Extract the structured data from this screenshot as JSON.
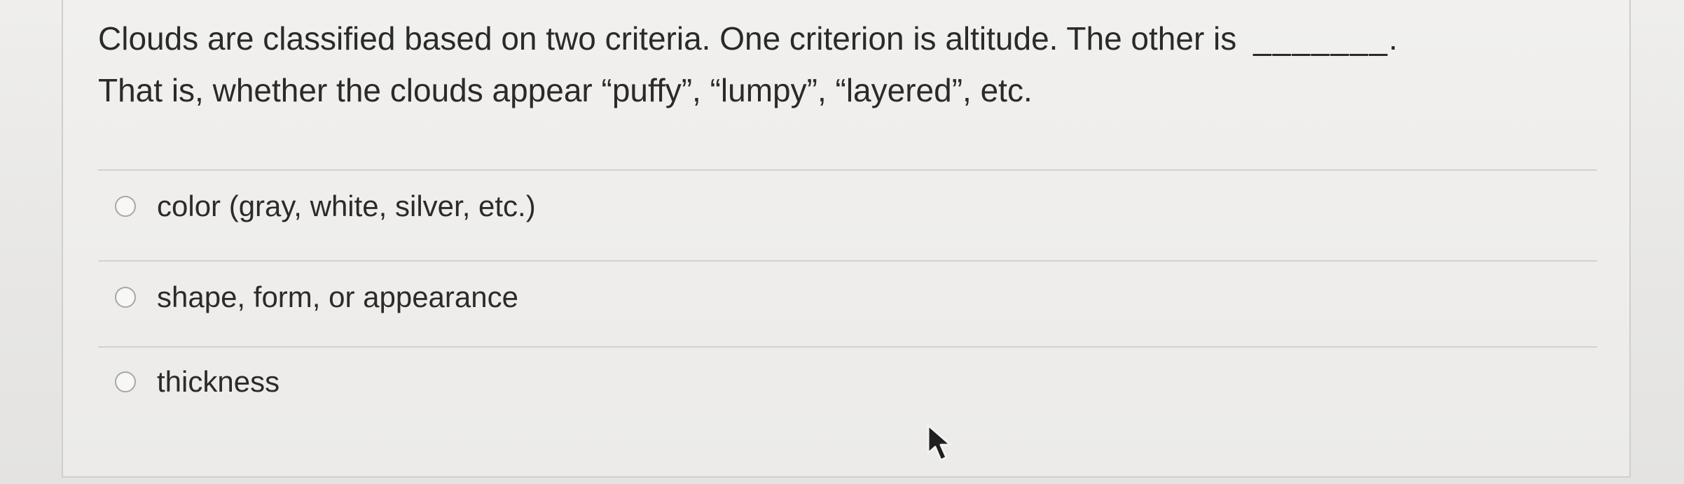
{
  "question": {
    "text": "Clouds are classified based on two criteria. One criterion is altitude. The other is",
    "blank": "_______.",
    "text_line2": "That is, whether the clouds appear “puffy”, “lumpy”, “layered”, etc."
  },
  "options": [
    {
      "label": "color (gray, white, silver, etc.)",
      "selected": false
    },
    {
      "label": "shape, form, or appearance",
      "selected": false
    },
    {
      "label": "thickness",
      "selected": false
    }
  ],
  "icons": {
    "cursor": "mouse-pointer-icon",
    "radio": "radio-button-icon"
  },
  "colors": {
    "text": "#2b2b2b",
    "divider": "#d3d2d0",
    "radio_border": "#a8a7a5"
  }
}
